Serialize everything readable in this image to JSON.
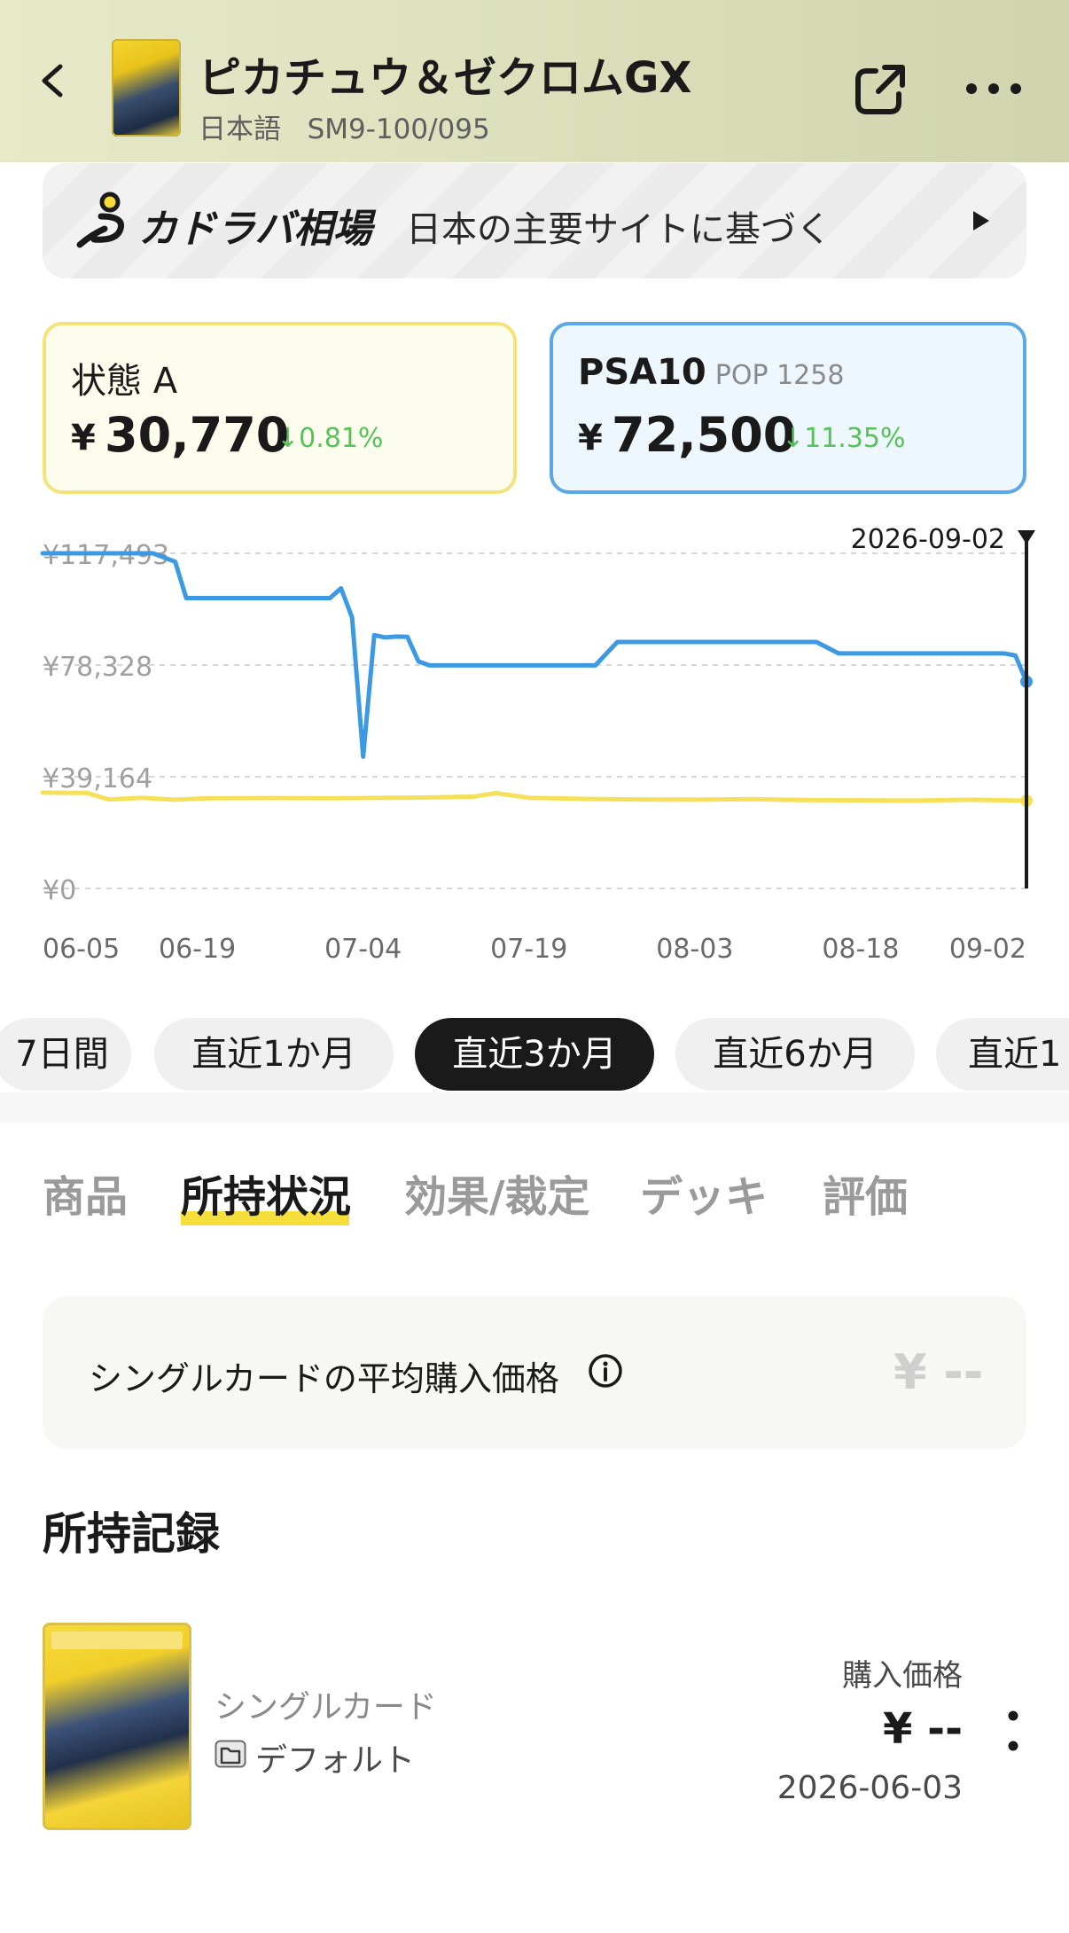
{
  "header": {
    "title": "ピカチュウ＆ゼクロムGX",
    "language": "日本語",
    "card_code": "SM9-100/095"
  },
  "banner": {
    "brand": "カドラバ相場",
    "note": "日本の主要サイトに基づく"
  },
  "price_cards": [
    {
      "condition": "状態 A",
      "currency": "¥",
      "price": "30,770",
      "change": "↓0.81%",
      "color": "#f6e27a"
    },
    {
      "condition": "PSA10",
      "pop": "POP 1258",
      "currency": "¥",
      "price": "72,500",
      "change": "↓11.35%",
      "color": "#5aa9e6"
    }
  ],
  "chart_data": {
    "type": "line",
    "ylim": [
      0,
      117493
    ],
    "y_ticks": [
      "¥117,493",
      "¥78,328",
      "¥39,164",
      "¥0"
    ],
    "y_tick_values": [
      117493,
      78328,
      39164,
      0
    ],
    "x_ticks": [
      "06-05",
      "06-19",
      "07-04",
      "07-19",
      "08-03",
      "08-18",
      "09-02"
    ],
    "x_tick_dates": [
      "2026-06-05",
      "2026-06-19",
      "2026-07-04",
      "2026-07-19",
      "2026-08-03",
      "2026-08-18",
      "2026-09-02"
    ],
    "cursor_date": "2026-09-02",
    "grid": true,
    "series": [
      {
        "color": "#3d9ae2",
        "x": [
          "2026-06-05",
          "2026-06-15",
          "2026-06-17",
          "2026-06-18",
          "2026-07-01",
          "2026-07-02",
          "2026-07-03",
          "2026-07-04",
          "2026-07-05",
          "2026-07-06",
          "2026-07-07",
          "2026-07-08",
          "2026-07-09",
          "2026-07-10",
          "2026-07-11",
          "2026-07-25",
          "2026-07-27",
          "2026-08-14",
          "2026-08-16",
          "2026-08-31",
          "2026-09-01",
          "2026-09-02"
        ],
        "y": [
          117493,
          117493,
          114500,
          101800,
          101800,
          105200,
          95000,
          46200,
          88800,
          88000,
          88300,
          88200,
          79600,
          78200,
          78200,
          78200,
          86400,
          86400,
          82400,
          82400,
          81700,
          72500
        ]
      },
      {
        "color": "#f6e05a",
        "x": [
          "2026-06-05",
          "2026-06-09",
          "2026-06-11",
          "2026-06-14",
          "2026-06-17",
          "2026-06-20",
          "2026-06-25",
          "2026-07-01",
          "2026-07-06",
          "2026-07-10",
          "2026-07-14",
          "2026-07-16",
          "2026-07-19",
          "2026-07-24",
          "2026-07-29",
          "2026-08-03",
          "2026-08-08",
          "2026-08-13",
          "2026-08-18",
          "2026-08-23",
          "2026-08-28",
          "2026-09-02"
        ],
        "y": [
          33600,
          33500,
          31200,
          31800,
          31100,
          31600,
          31700,
          31600,
          31800,
          31900,
          32200,
          33400,
          31800,
          31400,
          31200,
          31100,
          31300,
          31000,
          30900,
          30800,
          31100,
          30770
        ]
      }
    ]
  },
  "periods": [
    "7日間",
    "直近1か月",
    "直近3か月",
    "直近6か月",
    "直近1"
  ],
  "active_period": "直近3か月",
  "tabs": [
    "商品",
    "所持状況",
    "効果/裁定",
    "デッキ",
    "評価"
  ],
  "active_tab": "所持状況",
  "avg_price": {
    "label": "シングルカードの平均購入価格",
    "value": "¥ --"
  },
  "records_title": "所持記録",
  "record": {
    "type": "シングルカード",
    "folder": "デフォルト",
    "price_label": "購入価格",
    "price": "¥ --",
    "date": "2026-06-03"
  },
  "icons": [
    "back-icon",
    "share-icon",
    "more-icon",
    "play-icon",
    "info-icon",
    "folder-icon",
    "kebab-icon"
  ]
}
